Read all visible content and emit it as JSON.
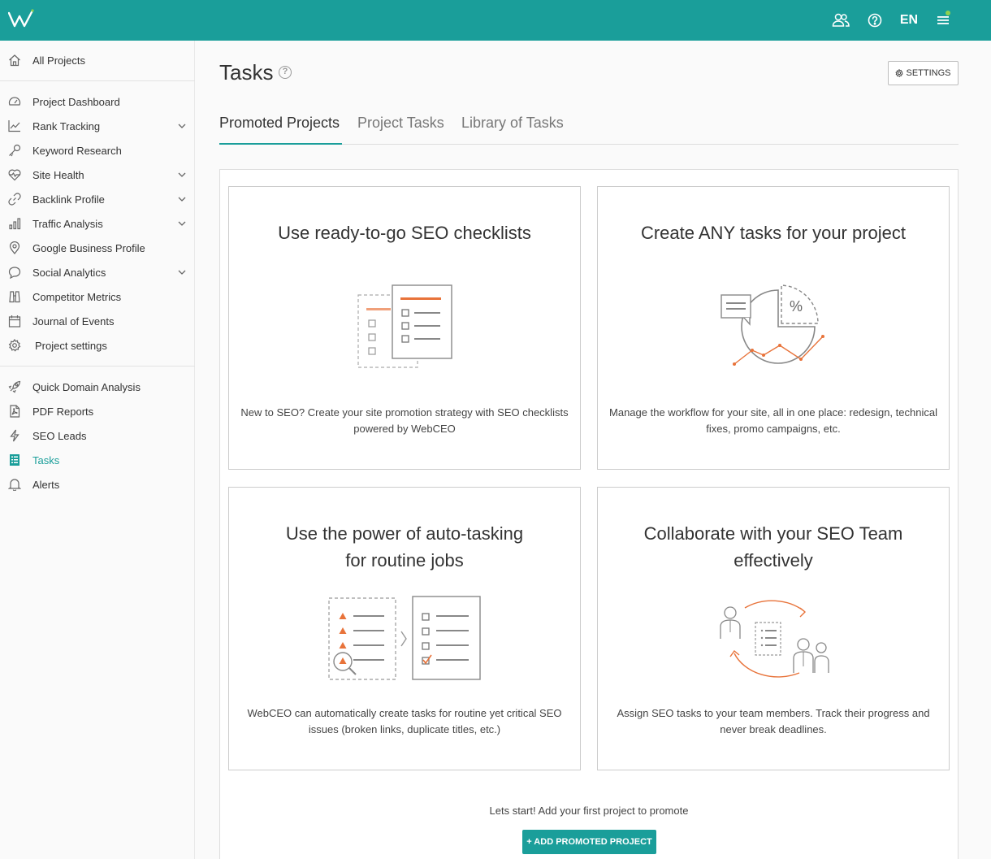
{
  "colors": {
    "brand": "#1a9e9a",
    "accent_orange": "#e8733a"
  },
  "topbar": {
    "lang": "EN",
    "icons": [
      "team-icon",
      "help-icon",
      "menu-icon"
    ]
  },
  "sidebar": {
    "all_projects": "All Projects",
    "items": [
      {
        "label": "Project Dashboard",
        "icon": "dashboard-icon",
        "expandable": false
      },
      {
        "label": "Rank Tracking",
        "icon": "rank-chart-icon",
        "expandable": true
      },
      {
        "label": "Keyword Research",
        "icon": "key-icon",
        "expandable": false
      },
      {
        "label": "Site Health",
        "icon": "heart-pulse-icon",
        "expandable": true
      },
      {
        "label": "Backlink Profile",
        "icon": "link-icon",
        "expandable": true
      },
      {
        "label": "Traffic Analysis",
        "icon": "bars-icon",
        "expandable": true
      },
      {
        "label": "Google Business Profile",
        "icon": "pin-icon",
        "expandable": false
      },
      {
        "label": "Social Analytics",
        "icon": "chat-icon",
        "expandable": true
      },
      {
        "label": "Competitor Metrics",
        "icon": "binoculars-icon",
        "expandable": false
      },
      {
        "label": "Journal of Events",
        "icon": "calendar-icon",
        "expandable": false
      },
      {
        "label": "Project settings",
        "icon": "gear-icon",
        "expandable": false
      }
    ],
    "tools": [
      {
        "label": "Quick Domain Analysis",
        "icon": "rocket-icon"
      },
      {
        "label": "PDF Reports",
        "icon": "pdf-icon"
      },
      {
        "label": "SEO Leads",
        "icon": "bolt-icon"
      },
      {
        "label": "Tasks",
        "icon": "tasks-icon",
        "active": true
      },
      {
        "label": "Alerts",
        "icon": "bell-icon"
      }
    ]
  },
  "main": {
    "title": "Tasks",
    "settings_label": "SETTINGS",
    "tabs": [
      {
        "label": "Promoted Projects",
        "active": true
      },
      {
        "label": "Project Tasks",
        "active": false
      },
      {
        "label": "Library of Tasks",
        "active": false
      }
    ],
    "cards": [
      {
        "title_line1": "Use ready-to-go SEO checklists",
        "title_line2": "",
        "desc": "New to SEO? Create your site promotion strategy with SEO checklists powered by WebCEO"
      },
      {
        "title_line1": "Create ANY tasks for your project",
        "title_line2": "",
        "desc": "Manage the workflow for your site, all in one place: redesign, technical fixes, promo campaigns, etc."
      },
      {
        "title_line1": "Use the power of auto-tasking",
        "title_line2": "for routine jobs",
        "desc": "WebCEO can automatically create tasks for routine yet critical SEO issues (broken links, duplicate titles, etc.)"
      },
      {
        "title_line1": "Collaborate with your SEO Team",
        "title_line2": "effectively",
        "desc": "Assign SEO tasks to your team members. Track their progress and never break deadlines."
      }
    ],
    "lets_start": "Lets start! Add your first project to promote",
    "add_button": "+ ADD PROMOTED PROJECT"
  }
}
